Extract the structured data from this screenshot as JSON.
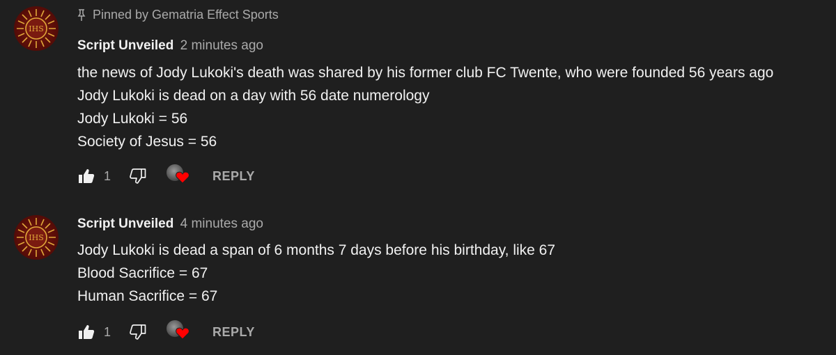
{
  "pinned": {
    "icon": "pin-icon",
    "text": "Pinned by Gematria Effect Sports"
  },
  "comments": [
    {
      "author": "Script Unveiled",
      "time": "2 minutes ago",
      "lines": [
        "the news of Jody Lukoki's death was shared by his former club FC Twente, who were founded 56 years ago",
        "Jody Lukoki is dead on a day with 56 date numerology",
        "Jody Lukoki = 56",
        "Society of Jesus = 56"
      ],
      "likes": "1",
      "reply_label": "REPLY",
      "hearted": true
    },
    {
      "author": "Script Unveiled",
      "time": "4 minutes ago",
      "lines": [
        "Jody Lukoki is dead a span of 6 months 7 days before his birthday, like 67",
        "Blood Sacrifice = 67",
        "Human Sacrifice = 67"
      ],
      "likes": "1",
      "reply_label": "REPLY",
      "hearted": true
    }
  ],
  "colors": {
    "background": "#1f1f1f",
    "text": "#f1f1f1",
    "secondary": "#aaaaaa",
    "heart": "#ff0000"
  }
}
